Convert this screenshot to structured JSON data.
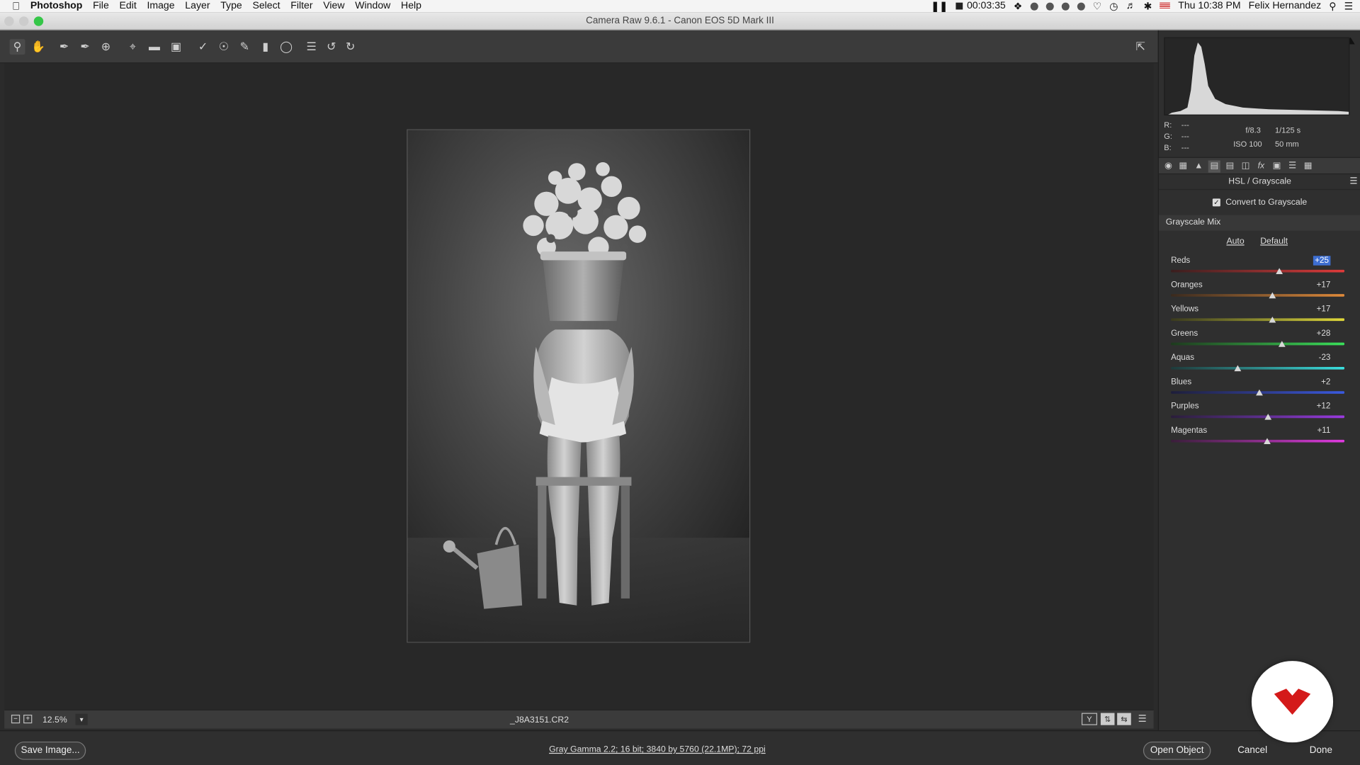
{
  "menubar": {
    "apple": "",
    "app": "Photoshop",
    "items": [
      "File",
      "Edit",
      "Image",
      "Layer",
      "Type",
      "Select",
      "Filter",
      "View",
      "Window",
      "Help"
    ],
    "timer": "00:03:35",
    "datetime": "Thu 10:38 PM",
    "user": "Felix Hernandez"
  },
  "window": {
    "title": "Camera Raw 9.6.1  -  Canon EOS 5D Mark III"
  },
  "toolbar": {
    "tools": [
      "zoom-tool",
      "hand-tool",
      "white-balance-tool",
      "color-sampler-tool",
      "targeted-adjustment-tool",
      "crop-tool",
      "straighten-tool",
      "transform-tool",
      "spot-removal-tool",
      "red-eye-removal-tool",
      "adjustment-brush",
      "graduated-filter",
      "radial-filter",
      "preferences",
      "rotate-ccw",
      "rotate-cw"
    ]
  },
  "canvas_bar": {
    "zoom": "12.5%",
    "filename": "_J8A3151.CR2"
  },
  "readout": {
    "r_label": "R:",
    "g_label": "G:",
    "b_label": "B:",
    "r": "---",
    "g": "---",
    "b": "---",
    "aperture": "f/8.3",
    "shutter": "1/125 s",
    "iso": "ISO 100",
    "focal": "50 mm"
  },
  "panel": {
    "title": "HSL / Grayscale",
    "convert_label": "Convert to Grayscale",
    "convert_checked": true,
    "mix_header": "Grayscale Mix",
    "auto": "Auto",
    "default": "Default",
    "sliders": [
      {
        "name": "Reds",
        "value": "+25",
        "num": 25,
        "selected": true,
        "grad": "linear-gradient(90deg,#3a1e1e,#8a2e2e,#e03a3a)"
      },
      {
        "name": "Oranges",
        "value": "+17",
        "num": 17,
        "selected": false,
        "grad": "linear-gradient(90deg,#3a2a1e,#8a5a2e,#e08a3a)"
      },
      {
        "name": "Yellows",
        "value": "+17",
        "num": 17,
        "selected": false,
        "grad": "linear-gradient(90deg,#3a3a1e,#8a8a2e,#e0d83a)"
      },
      {
        "name": "Greens",
        "value": "+28",
        "num": 28,
        "selected": false,
        "grad": "linear-gradient(90deg,#1e3a1e,#2e8a3a,#3ae05a)"
      },
      {
        "name": "Aquas",
        "value": "-23",
        "num": -23,
        "selected": false,
        "grad": "linear-gradient(90deg,#1e3a3a,#2e8a8a,#3ae0e0)"
      },
      {
        "name": "Blues",
        "value": "+2",
        "num": 2,
        "selected": false,
        "grad": "linear-gradient(90deg,#1e1e3a,#2e3a8a,#3a5ae0)"
      },
      {
        "name": "Purples",
        "value": "+12",
        "num": 12,
        "selected": false,
        "grad": "linear-gradient(90deg,#2a1e3a,#5a2e8a,#9a3ae0)"
      },
      {
        "name": "Magentas",
        "value": "+11",
        "num": 11,
        "selected": false,
        "grad": "linear-gradient(90deg,#3a1e3a,#8a2e8a,#e03ae0)"
      }
    ]
  },
  "footer": {
    "save": "Save Image...",
    "workflow": "Gray Gamma 2.2; 16 bit; 3840 by 5760 (22.1MP); 72 ppi",
    "open": "Open Object",
    "cancel": "Cancel",
    "done": "Done"
  },
  "colors": {
    "accent": "#3d6ed1",
    "logo_red": "#d41a1a"
  }
}
